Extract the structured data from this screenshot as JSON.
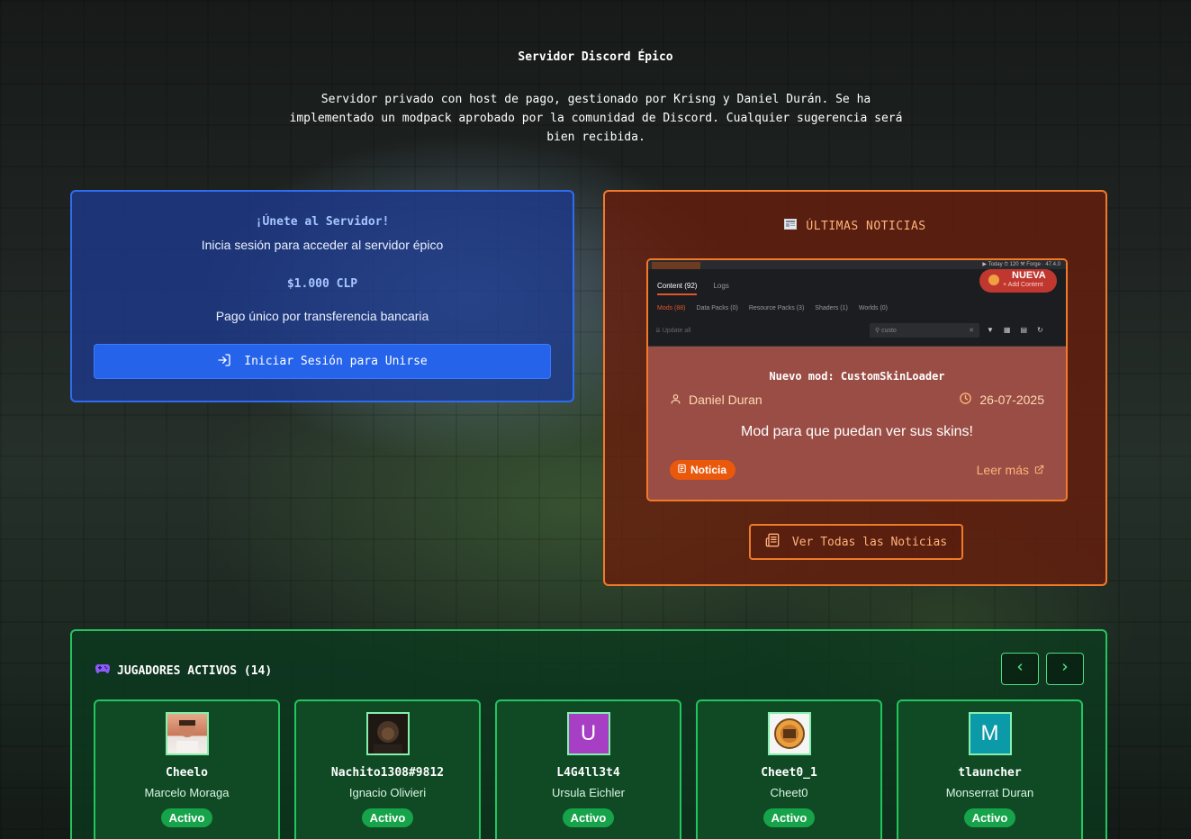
{
  "hero": {
    "title": "Servidor Discord Épico",
    "description": "Servidor privado con host de pago, gestionado por Krisng y Daniel Durán. Se ha implementado un modpack aprobado por la comunidad de Discord. Cualquier sugerencia será bien recibida."
  },
  "join": {
    "title": "¡Únete al Servidor!",
    "subtitle": "Inicia sesión para acceder al servidor épico",
    "price": "$1.000 CLP",
    "payment": "Pago único por transferencia bancaria",
    "button_label": "Iniciar Sesión para Unirse"
  },
  "news": {
    "header": "ÚLTIMAS NOTICIAS",
    "item": {
      "image": {
        "top_stats": "▶ Today   ⏱ 120   ⚒ Forge · 47.4.0",
        "tab_content": "Content (92)",
        "tab_logs": "Logs",
        "filters": [
          "Mods (88)",
          "Data Packs (0)",
          "Resource Packs (3)",
          "Shaders (1)",
          "Worlds (0)"
        ],
        "update_all": "Update all",
        "search_value": "custo",
        "badge_label": "NUEVA",
        "badge_sub": "+ Add Content"
      },
      "title": "Nuevo mod: CustomSkinLoader",
      "author": "Daniel Duran",
      "date": "26-07-2025",
      "text": "Mod para que puedan ver sus skins!",
      "tag": "Noticia",
      "read_more": "Leer más"
    },
    "all_button": "Ver Todas las Noticias"
  },
  "players": {
    "title": "JUGADORES ACTIVOS (14)",
    "list": [
      {
        "username": "Cheelo",
        "name": "Marcelo Moraga",
        "status": "Activo",
        "avatar_letter": "",
        "avatar_color": "#d98c6a"
      },
      {
        "username": "Nachito1308#9812",
        "name": "Ignacio Olivieri",
        "status": "Activo",
        "avatar_letter": "",
        "avatar_color": "#3a2a1e"
      },
      {
        "username": "L4G4ll3t4",
        "name": "Ursula Eichler",
        "status": "Activo",
        "avatar_letter": "U",
        "avatar_color": "#a73fc4"
      },
      {
        "username": "Cheet0_1",
        "name": "Cheet0",
        "status": "Activo",
        "avatar_letter": "",
        "avatar_color": "#f2f2f2"
      },
      {
        "username": "tlauncher",
        "name": "Monserrat Duran",
        "status": "Activo",
        "avatar_letter": "M",
        "avatar_color": "#0b9aa8"
      }
    ]
  },
  "colors": {
    "join_accent": "#2563eb",
    "news_accent": "#f07a2a",
    "players_accent": "#22c55e",
    "status_active": "#16a34a"
  }
}
